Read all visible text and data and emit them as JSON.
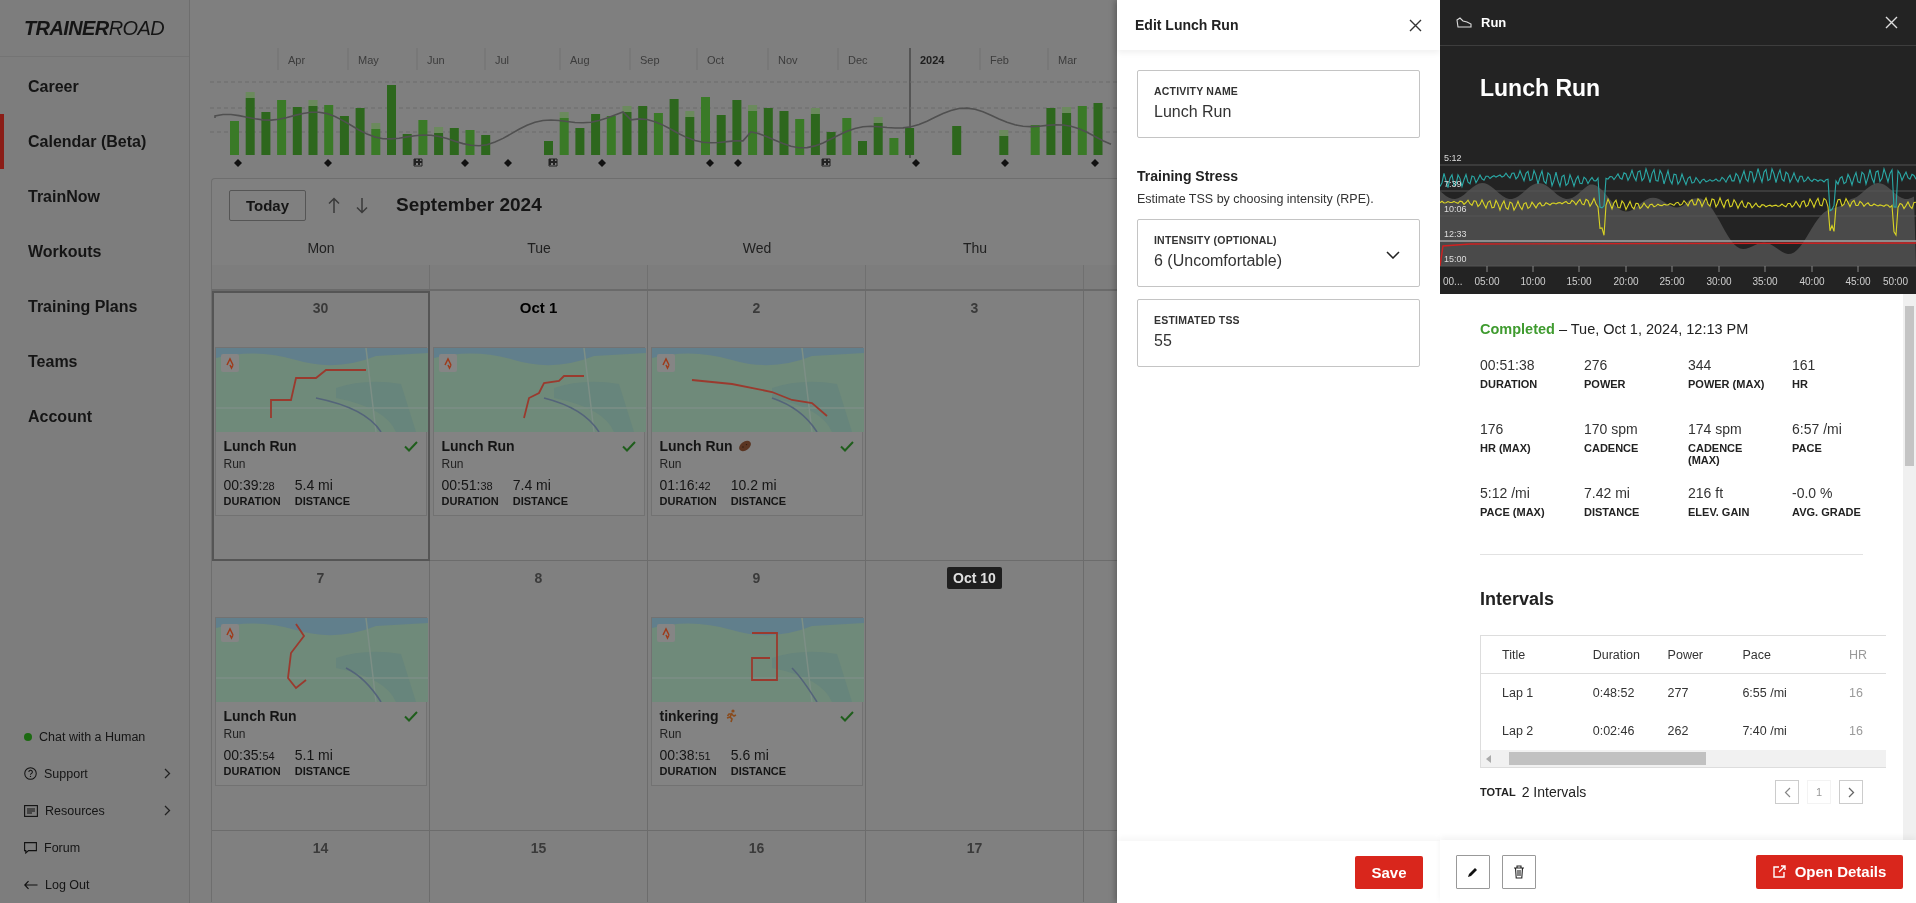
{
  "sidebar": {
    "logo": "**TRAINER**ROAD",
    "nav": [
      {
        "label": "Career",
        "selected": false
      },
      {
        "label": "Calendar (Beta)",
        "selected": true
      },
      {
        "label": "TrainNow",
        "selected": false
      },
      {
        "label": "Workouts",
        "selected": false
      },
      {
        "label": "Training Plans",
        "selected": false
      },
      {
        "label": "Teams",
        "selected": false
      },
      {
        "label": "Account",
        "selected": false
      }
    ],
    "footer_links": [
      {
        "label": "Chat with a Human",
        "kind": "status",
        "has_submenu": false
      },
      {
        "label": "Support",
        "kind": "help",
        "has_submenu": true
      },
      {
        "label": "Resources",
        "kind": "resources",
        "has_submenu": true
      },
      {
        "label": "Forum",
        "kind": "forum",
        "has_submenu": false
      },
      {
        "label": "Log Out",
        "kind": "logout",
        "has_submenu": false
      }
    ]
  },
  "history_chart": {
    "months": [
      "Apr",
      "May",
      "Jun",
      "Jul",
      "Aug",
      "Sep",
      "Oct",
      "Nov",
      "Dec",
      "2024",
      "Feb",
      "Mar"
    ]
  },
  "calendar": {
    "today_button": "Today",
    "title": "September 2024",
    "weekdays": [
      "Mon",
      "Tue",
      "Wed",
      "Thu"
    ],
    "weeks": [
      {
        "days": [
          {
            "label": "30",
            "selected": true,
            "month_start": false,
            "today": false,
            "activities": [
              {
                "title": "Lunch Run",
                "kind": "plain",
                "type": "Run",
                "duration": "00:39:",
                "duration_seconds": "28",
                "distance": "5.4 mi",
                "duration_label": "DURATION",
                "distance_label": "DISTANCE",
                "completed": true
              }
            ]
          },
          {
            "label": "Oct 1",
            "selected": false,
            "month_start": true,
            "today": false,
            "activities": [
              {
                "title": "Lunch Run",
                "kind": "plain",
                "type": "Run",
                "duration": "00:51:",
                "duration_seconds": "38",
                "distance": "7.4 mi",
                "duration_label": "DURATION",
                "distance_label": "DISTANCE",
                "completed": true
              }
            ]
          },
          {
            "label": "2",
            "selected": false,
            "month_start": false,
            "today": false,
            "activities": [
              {
                "title": "Lunch Run",
                "kind": "potato",
                "type": "Run",
                "duration": "01:16:",
                "duration_seconds": "42",
                "distance": "10.2 mi",
                "duration_label": "DURATION",
                "distance_label": "DISTANCE",
                "completed": true
              }
            ]
          },
          {
            "label": "3",
            "selected": false,
            "month_start": false,
            "today": false
          }
        ]
      },
      {
        "days": [
          {
            "label": "7",
            "selected": false,
            "month_start": false,
            "today": false,
            "activities": [
              {
                "title": "Lunch Run",
                "kind": "plain",
                "type": "Run",
                "duration": "00:35:",
                "duration_seconds": "54",
                "distance": "5.1 mi",
                "duration_label": "DURATION",
                "distance_label": "DISTANCE",
                "completed": true
              }
            ]
          },
          {
            "label": "8",
            "selected": false,
            "month_start": false,
            "today": false
          },
          {
            "label": "9",
            "selected": false,
            "month_start": false,
            "today": false,
            "activities": [
              {
                "title": "tinkering",
                "kind": "runner",
                "type": "Run",
                "duration": "00:38:",
                "duration_seconds": "51",
                "distance": "5.6 mi",
                "duration_label": "DURATION",
                "distance_label": "DISTANCE",
                "completed": true
              }
            ]
          },
          {
            "label": "Oct 10",
            "selected": false,
            "month_start": false,
            "today": true
          }
        ]
      },
      {
        "days": [
          {
            "label": "14",
            "selected": false,
            "month_start": false,
            "today": false
          },
          {
            "label": "15",
            "selected": false,
            "month_start": false,
            "today": false
          },
          {
            "label": "16",
            "selected": false,
            "month_start": false,
            "today": false
          },
          {
            "label": "17",
            "selected": false,
            "month_start": false,
            "today": false
          }
        ]
      }
    ]
  },
  "edit_panel": {
    "title": "Edit Lunch Run",
    "name_field": {
      "label": "ACTIVITY NAME",
      "value": "Lunch Run"
    },
    "training_stress": {
      "title": "Training Stress",
      "description": "Estimate TSS by choosing intensity (RPE)."
    },
    "intensity_field": {
      "label": "INTENSITY (OPTIONAL)",
      "value": "6 (Uncomfortable)"
    },
    "tss_field": {
      "label": "ESTIMATED TSS",
      "value": "55"
    },
    "save_button": "Save"
  },
  "run_panel": {
    "type_label": "Run",
    "title": "Lunch Run",
    "chart": {
      "y_labels": [
        "5:12",
        "7:39",
        "10:06",
        "12:33",
        "15:00"
      ],
      "x_labels": [
        "00...",
        "05:00",
        "10:00",
        "15:00",
        "20:00",
        "25:00",
        "30:00",
        "35:00",
        "40:00",
        "45:00",
        "50:00"
      ]
    },
    "status": "Completed",
    "completed_at": "– Tue, Oct 1, 2024, 12:13 PM",
    "stats": [
      {
        "value": "00:51:38",
        "label": "DURATION"
      },
      {
        "value": "276",
        "label": "POWER"
      },
      {
        "value": "344",
        "label": "POWER (MAX)"
      },
      {
        "value": "161",
        "label": "HR"
      },
      {
        "value": "176",
        "label": "HR (MAX)"
      },
      {
        "value": "170 spm",
        "label": "CADENCE"
      },
      {
        "value": "174 spm",
        "label": "CADENCE (MAX)"
      },
      {
        "value": "6:57 /mi",
        "label": "PACE"
      },
      {
        "value": "5:12 /mi",
        "label": "PACE (MAX)"
      },
      {
        "value": "7.42 mi",
        "label": "DISTANCE"
      },
      {
        "value": "216 ft",
        "label": "ELEV. GAIN"
      },
      {
        "value": "-0.0 %",
        "label": "AVG. GRADE"
      }
    ],
    "intervals": {
      "title": "Intervals",
      "columns": [
        "Title",
        "Duration",
        "Power",
        "Pace",
        "HR"
      ],
      "rows": [
        [
          "Lap 1",
          "0:48:52",
          "277",
          "6:55 /mi",
          "16"
        ],
        [
          "Lap 2",
          "0:02:46",
          "262",
          "7:40 /mi",
          "16"
        ]
      ],
      "total_label": "TOTAL",
      "total_value": "2 Intervals",
      "page": "1"
    },
    "open_details": "Open Details"
  }
}
